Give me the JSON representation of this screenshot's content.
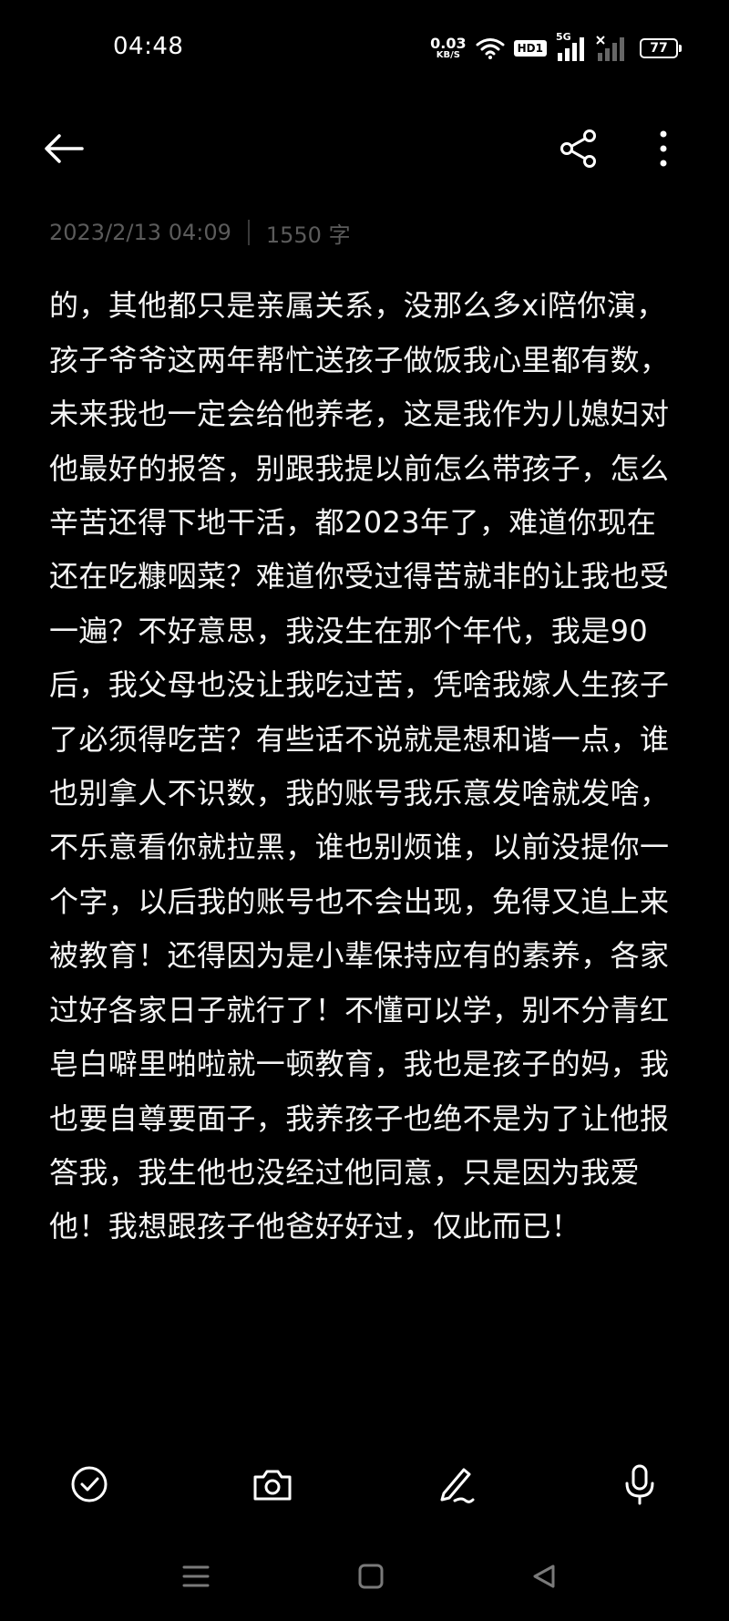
{
  "status_bar": {
    "time": "04:48",
    "net_speed_value": "0.03",
    "net_speed_unit": "KB/S",
    "hd_label": "HD1",
    "network_label": "5G",
    "battery_level": "77"
  },
  "toolbar": {
    "back_icon": "arrow-left-icon",
    "share_icon": "share-icon",
    "more_icon": "more-vertical-icon"
  },
  "note_meta": {
    "datetime": "2023/2/13 04:09",
    "word_count": "1550 字"
  },
  "note": {
    "body": "不是你给我养大的，这辈子除了我生的是肯养我的，其他都只是亲属关系，没那么多xi陪你演，孩子爷爷这两年帮忙送孩子做饭我心里都有数，未来我也一定会给他养老，这是我作为儿媳妇对他最好的报答，别跟我提以前怎么带孩子，怎么辛苦还得下地干活，都2023年了，难道你现在还在吃糠咽菜？难道你受过得苦就非的让我也受一遍？不好意思，我没生在那个年代，我是90后，我父母也没让我吃过苦，凭啥我嫁人生孩子了必须得吃苦？有些话不说就是想和谐一点，谁也别拿人不识数，我的账号我乐意发啥就发啥，不乐意看你就拉黑，谁也别烦谁，以前没提你一个字，以后我的账号也不会出现，免得又追上来被教育！还得因为是小辈保持应有的素养，各家过好各家日子就行了！不懂可以学，别不分青红皂白噼里啪啦就一顿教育，我也是孩子的妈，我也要自尊要面子，我养孩子也绝不是为了让他报答我，我生他也没经过他同意，只是因为我爱他！我想跟孩子他爸好好过，仅此而已！"
  },
  "edit_bar": {
    "check_icon": "checklist-circle-icon",
    "camera_icon": "camera-icon",
    "pen_icon": "handwriting-pen-icon",
    "mic_icon": "microphone-icon"
  },
  "nav_bar": {
    "menu_icon": "recent-apps-icon",
    "home_icon": "home-square-icon",
    "back_icon": "back-triangle-icon"
  },
  "colors": {
    "background": "#000000",
    "text": "#f4f4f4",
    "meta_text": "#5b5b5b"
  }
}
